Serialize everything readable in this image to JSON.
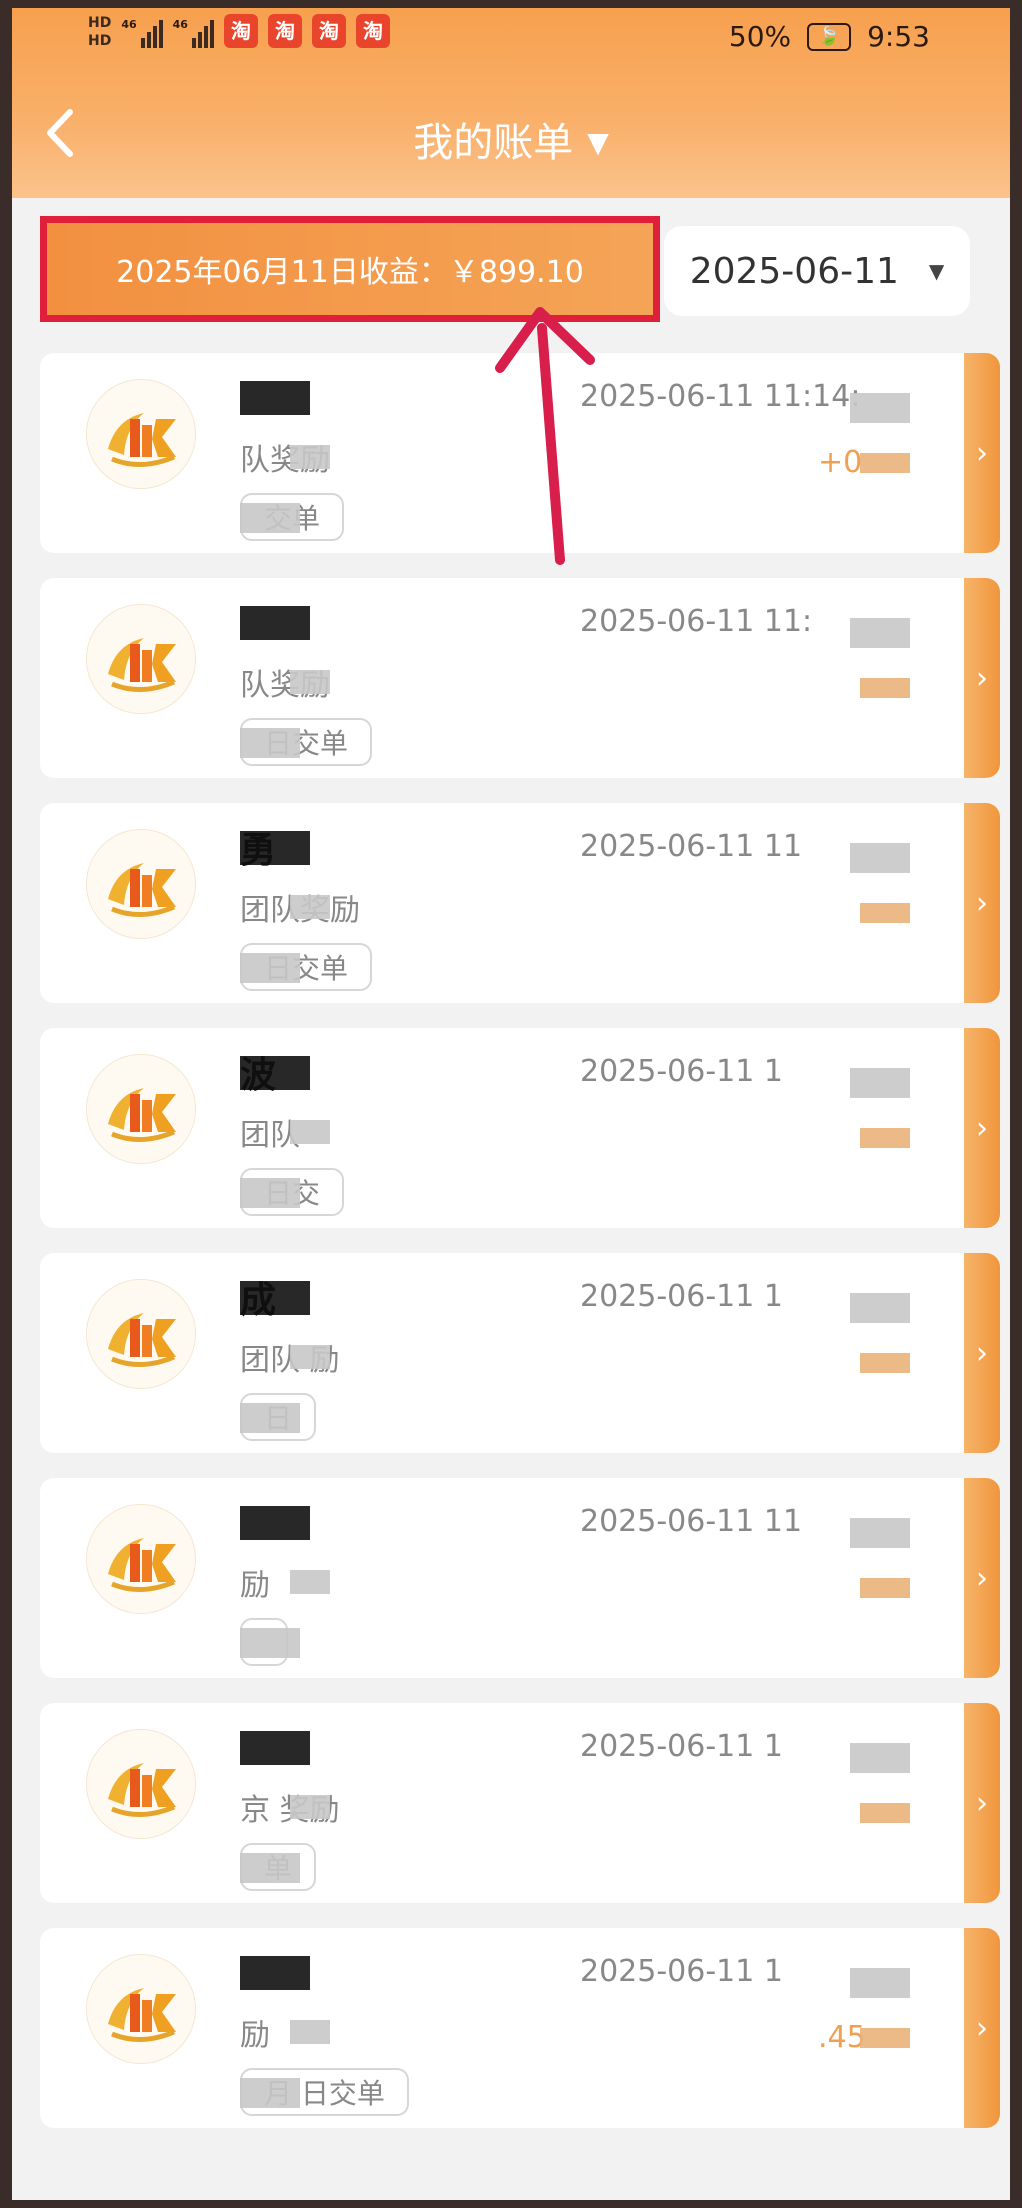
{
  "status_bar": {
    "left_labels": [
      "HD",
      "HD",
      "46",
      "46"
    ],
    "taobao_glyph": "淘",
    "battery": "50%",
    "battery_icon_glyph": "🍃",
    "time": "9:53"
  },
  "nav": {
    "title": "我的账单",
    "back_icon": "chevron-left-icon",
    "dropdown_icon": "triangle-down-icon"
  },
  "summary": {
    "text": "2025年06月11日收益：￥899.10"
  },
  "date_picker": {
    "value": "2025-06-11",
    "caret": "▼"
  },
  "side_arrow": "›",
  "colors": {
    "header": "#f7a04e",
    "highlight_border": "#e0203a",
    "amount": "#f0a050",
    "annotation_arrow": "#d81e4a"
  },
  "records": [
    {
      "name": "",
      "name_tail": "",
      "subtitle": "队奖励",
      "tag": "交单",
      "time": "2025-06-11 11:14:",
      "amount": "+0"
    },
    {
      "name": "",
      "name_tail": "",
      "subtitle": "队奖励",
      "tag": "日交单",
      "time": "2025-06-11 11:",
      "amount": ""
    },
    {
      "name": "",
      "name_tail": "勇",
      "subtitle": "团队奖励",
      "tag": "日交单",
      "time": "2025-06-11 11",
      "amount": ""
    },
    {
      "name": "",
      "name_tail": "波",
      "subtitle": "团队",
      "tag": "日交",
      "time": "2025-06-11 1",
      "amount": ""
    },
    {
      "name": "",
      "name_tail": "成",
      "subtitle": "团队  励",
      "tag": "日",
      "time": "2025-06-11 1",
      "amount": ""
    },
    {
      "name": "",
      "name_tail": "",
      "subtitle": "励",
      "tag": "",
      "time": "2025-06-11 11",
      "amount": ""
    },
    {
      "name": "",
      "name_tail": "",
      "subtitle": "京   奖励",
      "tag": "单",
      "time": "2025-06-11 1",
      "amount": ""
    },
    {
      "name": "",
      "name_tail": "",
      "subtitle": "励",
      "tag": "月  日交单",
      "time": "2025-06-11 1",
      "amount": ".45"
    }
  ]
}
